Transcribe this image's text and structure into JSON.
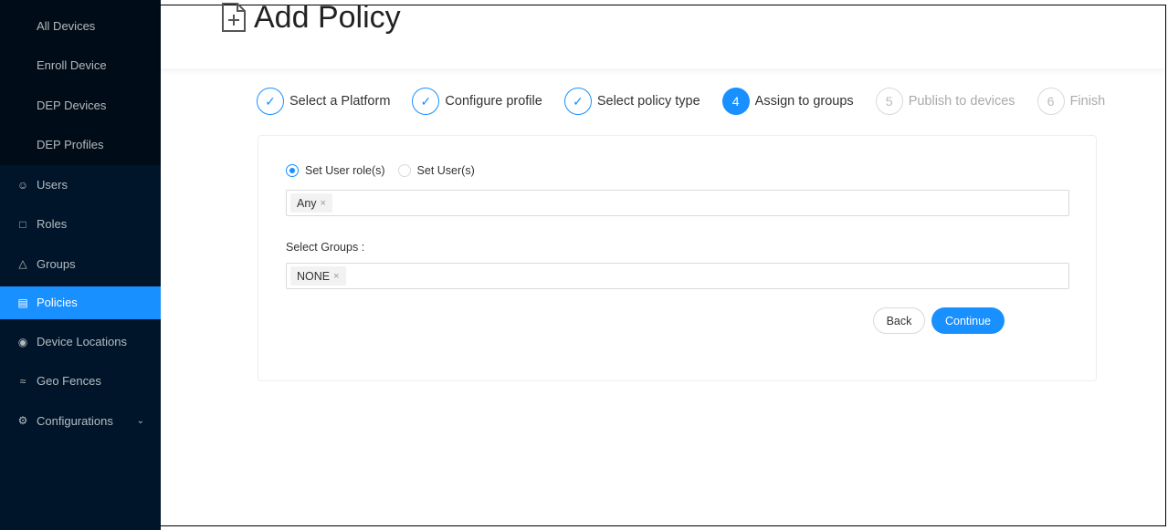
{
  "sidebar": {
    "submenu": [
      "All Devices",
      "Enroll Device",
      "DEP Devices",
      "DEP Profiles"
    ],
    "items": [
      {
        "label": "Users",
        "icon": "user-icon"
      },
      {
        "label": "Roles",
        "icon": "book-icon"
      },
      {
        "label": "Groups",
        "icon": "cluster-icon"
      },
      {
        "label": "Policies",
        "icon": "policy-icon",
        "active": true
      },
      {
        "label": "Device Locations",
        "icon": "location-icon"
      },
      {
        "label": "Geo Fences",
        "icon": "geo-fence-icon"
      },
      {
        "label": "Configurations",
        "icon": "gear-icon"
      }
    ]
  },
  "header": {
    "title": "Add Policy"
  },
  "steps": [
    {
      "n": "1",
      "label": "Select a Platform",
      "status": "done"
    },
    {
      "n": "2",
      "label": "Configure profile",
      "status": "done"
    },
    {
      "n": "3",
      "label": "Select policy type",
      "status": "done"
    },
    {
      "n": "4",
      "label": "Assign to groups",
      "status": "current"
    },
    {
      "n": "5",
      "label": "Publish to devices",
      "status": "wait"
    },
    {
      "n": "6",
      "label": "Finish",
      "status": "wait"
    }
  ],
  "form": {
    "radio_roles": "Set User role(s)",
    "radio_users": "Set User(s)",
    "selected_radio": "Set User role(s)",
    "role_tag": "Any",
    "groups_label": "Select Groups",
    "group_tag": "NONE"
  },
  "buttons": {
    "back": "Back",
    "continue": "Continue"
  },
  "colors": {
    "accent": "#1890ff",
    "sidebar": "#001529"
  }
}
